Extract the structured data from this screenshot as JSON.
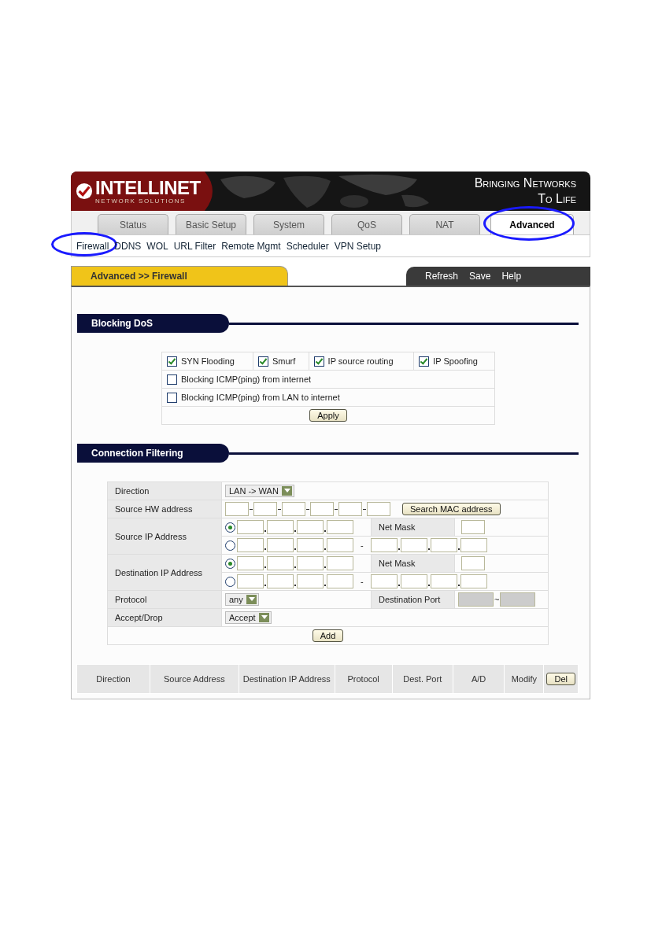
{
  "header": {
    "logo": "INTELLINET",
    "logo_tagline": "NETWORK SOLUTIONS",
    "slogan_line_1": "Bringing Networks",
    "slogan_line_2": "To Life"
  },
  "tabs": [
    {
      "label": "Status",
      "selected": false,
      "circled": false
    },
    {
      "label": "Basic Setup",
      "selected": false,
      "circled": false
    },
    {
      "label": "System",
      "selected": false,
      "circled": false
    },
    {
      "label": "QoS",
      "selected": false,
      "circled": false
    },
    {
      "label": "NAT",
      "selected": false,
      "circled": false
    },
    {
      "label": "Advanced",
      "selected": true,
      "circled": true
    }
  ],
  "subnav": [
    {
      "label": "Firewall",
      "circled": true
    },
    {
      "label": "DDNS",
      "circled": false
    },
    {
      "label": "WOL",
      "circled": false
    },
    {
      "label": "URL Filter",
      "circled": false
    },
    {
      "label": "Remote Mgmt",
      "circled": false
    },
    {
      "label": "Scheduler",
      "circled": false
    },
    {
      "label": "VPN Setup",
      "circled": false
    }
  ],
  "breadcrumb": "Advanced >> Firewall",
  "actions": [
    "Refresh",
    "Save",
    "Help"
  ],
  "blocking_dos": {
    "title": "Blocking DoS",
    "top_options": [
      {
        "label": "SYN Flooding",
        "checked": true
      },
      {
        "label": "Smurf",
        "checked": true
      },
      {
        "label": "IP source routing",
        "checked": true
      },
      {
        "label": "IP Spoofing",
        "checked": true
      }
    ],
    "options": [
      {
        "label": "Blocking ICMP(ping) from internet",
        "checked": false
      },
      {
        "label": "Blocking ICMP(ping) from LAN to internet",
        "checked": false
      }
    ],
    "apply_button": "Apply"
  },
  "connection_filtering": {
    "title": "Connection Filtering",
    "direction": {
      "label": "Direction",
      "value": "LAN -> WAN"
    },
    "source_hw": {
      "label": "Source HW address",
      "button": "Search MAC address"
    },
    "source_ip": {
      "label": "Source IP Address",
      "options": [
        {
          "kind": "subnet",
          "selected": true,
          "mask_label": "Net Mask"
        },
        {
          "kind": "range",
          "selected": false,
          "range_separator": "-"
        }
      ]
    },
    "destination_ip": {
      "label": "Destination IP Address",
      "options": [
        {
          "kind": "subnet",
          "selected": true,
          "mask_label": "Net Mask"
        },
        {
          "kind": "range",
          "selected": false,
          "range_separator": "-"
        }
      ]
    },
    "protocol": {
      "label": "Protocol",
      "value": "any",
      "port_label": "Destination Port",
      "port_separator": "~"
    },
    "accept_drop": {
      "label": "Accept/Drop",
      "value": "Accept"
    },
    "add_button": "Add"
  },
  "rules_table": {
    "columns": [
      "Direction",
      "Source Address",
      "Destination IP Address",
      "Protocol",
      "Dest. Port",
      "A/D",
      "Modify"
    ],
    "delete_button": "Del"
  }
}
